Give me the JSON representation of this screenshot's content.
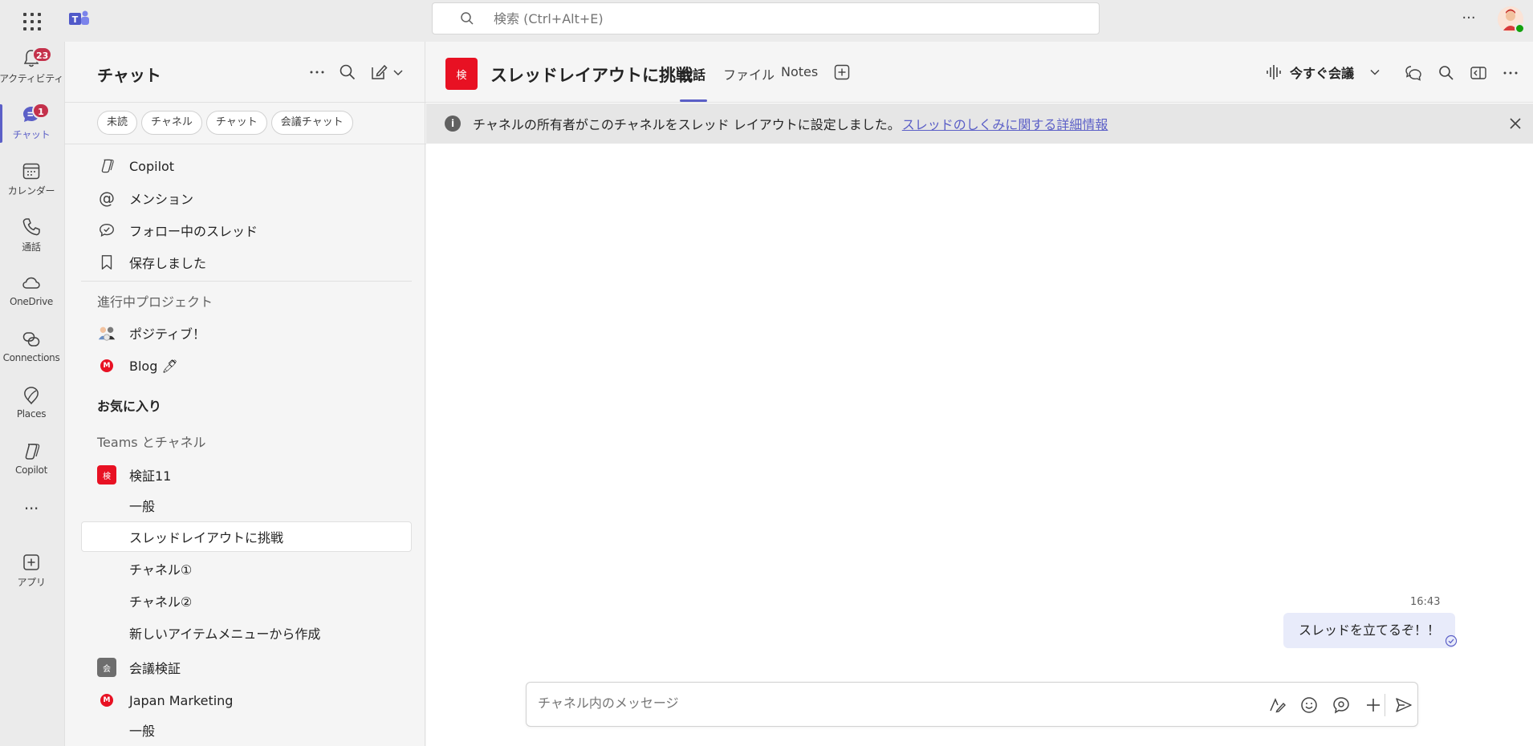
{
  "topbar": {
    "search_placeholder": "検索 (Ctrl+Alt+E)",
    "more_label": "···"
  },
  "rail": {
    "items": [
      {
        "label": "アクティビティ",
        "icon": "bell-icon",
        "badge": "23"
      },
      {
        "label": "チャット",
        "icon": "chat-icon",
        "badge": "1"
      },
      {
        "label": "カレンダー",
        "icon": "calendar-icon"
      },
      {
        "label": "通話",
        "icon": "phone-icon"
      },
      {
        "label": "OneDrive",
        "icon": "cloud-icon"
      },
      {
        "label": "Connections",
        "icon": "connections-icon"
      },
      {
        "label": "Places",
        "icon": "places-icon"
      },
      {
        "label": "Copilot",
        "icon": "copilot-icon"
      },
      {
        "label": "···",
        "icon": "more-apps-icon"
      },
      {
        "label": "アプリ",
        "icon": "add-app-icon"
      }
    ]
  },
  "panel": {
    "title": "チャット",
    "filters": [
      "未読",
      "チャネル",
      "チャット",
      "会議チャット"
    ],
    "quick": [
      {
        "label": "Copilot",
        "icon": "copilot-icon"
      },
      {
        "label": "メンション",
        "icon": "at-icon"
      },
      {
        "label": "フォロー中のスレッド",
        "icon": "followed-threads-icon"
      },
      {
        "label": "保存しました",
        "icon": "bookmark-icon"
      }
    ],
    "section_projects": "進行中プロジェクト",
    "projects": [
      {
        "label": "ポジティブ！",
        "icon": "group-avatar-icon"
      },
      {
        "label": "Blog 🖊",
        "icon": "m-badge-icon",
        "badge": "M"
      }
    ],
    "section_favorites": "お気に入り",
    "section_teams": "Teams とチャネル",
    "teams": [
      {
        "name": "検証11",
        "tile": "検",
        "color": "#e81123",
        "channels": [
          "一般",
          "スレッドレイアウトに挑戦",
          "チャネル①",
          "チャネル②",
          "新しいアイテムメニューから作成"
        ]
      },
      {
        "name": "会議検証",
        "tile": "会",
        "color": "#6e6e6e",
        "channels": []
      },
      {
        "name": "Japan Marketing",
        "tile": "M",
        "color": "#e81123",
        "channels": [
          "一般"
        ]
      }
    ]
  },
  "channel": {
    "tile": "検",
    "name": "スレッドレイアウトに挑戦",
    "tabs": [
      "会話",
      "ファイル",
      "Notes"
    ],
    "meet_label": "今すぐ会議",
    "banner_text": "チャネルの所有者がこのチャネルをスレッド レイアウトに設定しました。",
    "banner_link": "スレッドのしくみに関する詳細情報"
  },
  "message": {
    "time": "16:43",
    "text": "スレッドを立てるぞ！！"
  },
  "composer": {
    "placeholder": "チャネル内のメッセージ"
  }
}
